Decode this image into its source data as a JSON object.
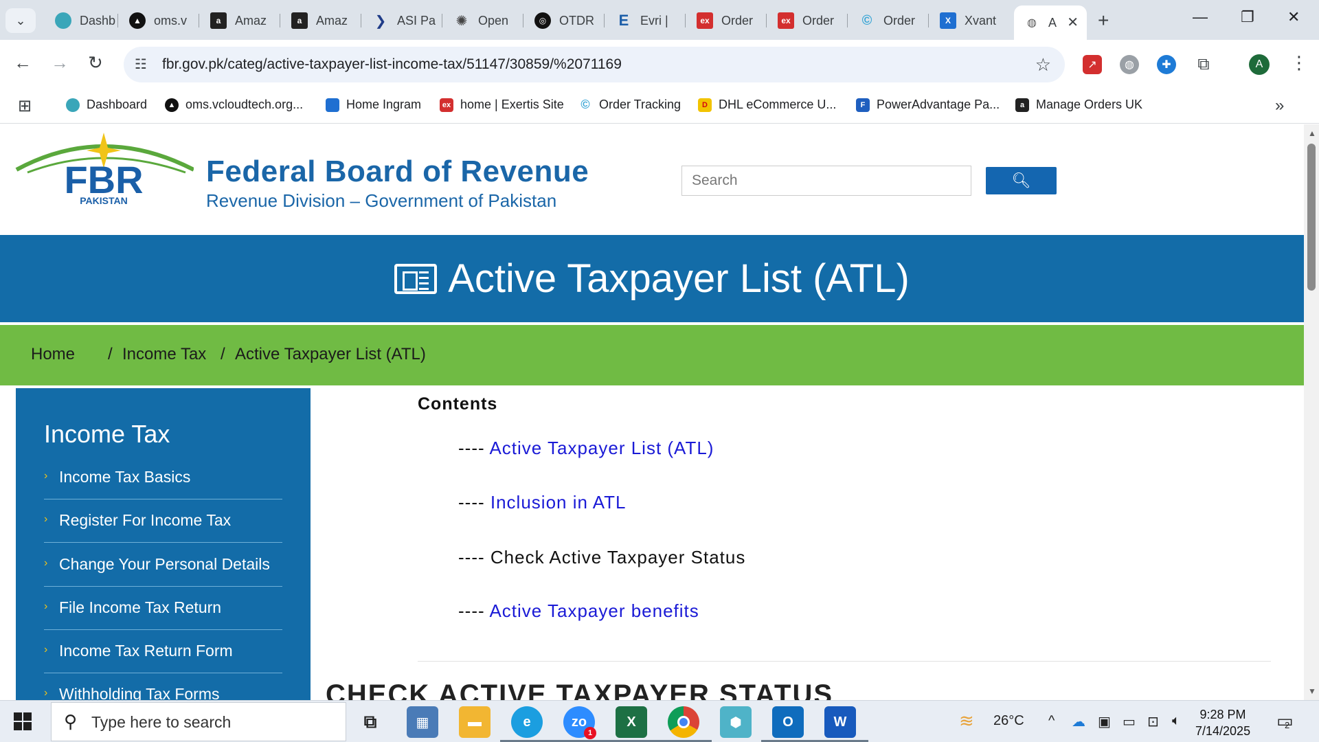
{
  "browser": {
    "tabs": [
      {
        "label": "Dashb",
        "fav_color": "#3aa6b9"
      },
      {
        "label": "oms.v",
        "fav_color": "#111111"
      },
      {
        "label": "Amaz",
        "fav_color": "#222222"
      },
      {
        "label": "Amaz",
        "fav_color": "#222222"
      },
      {
        "label": "ASI Pa",
        "fav_color": "#1f3c88"
      },
      {
        "label": "Open",
        "fav_color": "#444444"
      },
      {
        "label": "OTDR",
        "fav_color": "#111111"
      },
      {
        "label": "Evri |",
        "fav_color": "#1c5ea8"
      },
      {
        "label": "Order",
        "fav_color": "#d32f2f"
      },
      {
        "label": "Order",
        "fav_color": "#d32f2f"
      },
      {
        "label": "Order",
        "fav_color": "#3aa6d6"
      },
      {
        "label": "Xvant",
        "fav_color": "#1f6fd1"
      },
      {
        "label": "A",
        "fav_color": "#555555"
      }
    ],
    "url": "fbr.gov.pk/categ/active-taxpayer-list-income-tax/51147/30859/%2071169",
    "avatar_letter": "A",
    "bookmarks": [
      {
        "label": "Dashboard",
        "fav_color": "#3aa6b9"
      },
      {
        "label": "oms.vcloudtech.org...",
        "fav_color": "#111111"
      },
      {
        "label": "Home Ingram",
        "fav_color": "#1f6fd1"
      },
      {
        "label": "home | Exertis Site",
        "fav_color": "#d32f2f"
      },
      {
        "label": "Order Tracking",
        "fav_color": "#3aa6d6"
      },
      {
        "label": "DHL eCommerce U...",
        "fav_color": "#f2c300"
      },
      {
        "label": "PowerAdvantage Pa...",
        "fav_color": "#1f5fbf"
      },
      {
        "label": "Manage Orders UK",
        "fav_color": "#222222"
      }
    ]
  },
  "site": {
    "org_name": "Federal Board of Revenue",
    "org_sub": "Revenue Division – Government of Pakistan",
    "logo_text": "FBR",
    "logo_country": "PAKISTAN",
    "search_placeholder": "Search",
    "banner_title": "Active Taxpayer List (ATL)",
    "breadcrumb": {
      "home": "Home",
      "income_tax": "Income Tax",
      "current": "Active Taxpayer List (ATL)",
      "separator": "/"
    },
    "sidebar": {
      "heading": "Income Tax",
      "items": [
        "Income Tax Basics",
        "Register For Income Tax",
        "Change Your Personal Details",
        "File Income Tax Return",
        "Income Tax Return Form",
        "Withholding Tax Forms"
      ]
    },
    "contents": {
      "heading": "Contents",
      "dash": "----",
      "items": [
        {
          "label": "Active Taxpayer List (ATL)",
          "is_link": true
        },
        {
          "label": "Inclusion in ATL",
          "is_link": true
        },
        {
          "label": "Check Active Taxpayer Status",
          "is_link": false
        },
        {
          "label": "Active Taxpayer benefits",
          "is_link": true
        }
      ]
    },
    "section_title": "CHECK ACTIVE TAXPAYER STATUS",
    "colors": {
      "banner": "#136ca8",
      "breadcrumb_bar": "#70bb44",
      "link": "#1a1ad6",
      "brand_blue": "#1a66a8",
      "chevron": "#f0c419"
    }
  },
  "taskbar": {
    "search_placeholder": "Type here to search",
    "weather": "26°C",
    "time": "9:28 PM",
    "date": "7/14/2025",
    "notification_count": "2",
    "zoom_badge": "1"
  }
}
